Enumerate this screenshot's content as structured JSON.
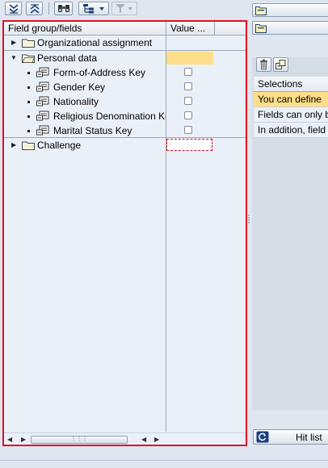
{
  "table": {
    "col_field": "Field group/fields",
    "col_value": "Value ...",
    "rows": [
      {
        "label": "Organizational assignment"
      },
      {
        "label": "Personal data"
      },
      {
        "label": "Form-of-Address Key"
      },
      {
        "label": "Gender Key"
      },
      {
        "label": "Nationality"
      },
      {
        "label": "Religious Denomination Key"
      },
      {
        "label": "Marital Status Key"
      },
      {
        "label": "Challenge"
      }
    ]
  },
  "right": {
    "selections_header": "Selections",
    "line1": "You can define",
    "line2": "Fields can only b",
    "line3": "In addition, field",
    "hit_list_label": "Hit list"
  },
  "colors": {
    "highlight": "#ffde8a",
    "focus_border": "#e01020",
    "panel_bg": "#eaf0f7"
  },
  "icons": [
    "expand-all-icon",
    "collapse-all-icon",
    "find-icon",
    "hierarchy-icon",
    "filter-icon",
    "folder-icon",
    "field-icon",
    "trash-icon",
    "clear-selection-icon",
    "refresh-icon"
  ]
}
